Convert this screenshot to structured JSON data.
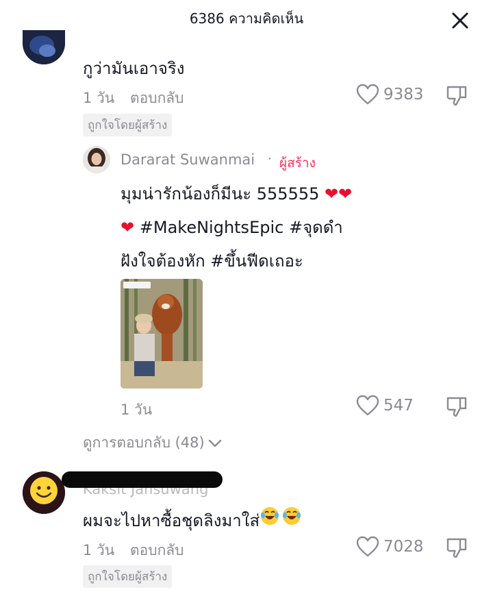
{
  "header": {
    "title": "6386 ความคิดเห็น"
  },
  "comment1": {
    "text": "กูว่ามันเอาจริง",
    "time": "1 วัน",
    "reply_label": "ตอบกลับ",
    "likes": "9383",
    "liked_by_creator": "ถูกใจโดยผู้สร้าง"
  },
  "reply1": {
    "author": "Dararat Suwanmai",
    "separator": "·",
    "creator_label": "ผู้สร้าง",
    "line1_text": "มุมน่ารักน้องก็มีนะ 555555",
    "line2_text": "#MakeNightsEpic  #จุดดำ",
    "line3_text": "ฝังใจต้องหัก #ขึ้นฟีดเถอะ",
    "time": "1 วัน",
    "likes": "547"
  },
  "view_replies": {
    "label": "ดูการตอบกลับ (48)"
  },
  "comment2": {
    "author_partial": "Kaksit Jansuwang",
    "text": "ผมจะไปหาซื้อชุดลิงมาใส่",
    "time": "1 วัน",
    "reply_label": "ตอบกลับ",
    "likes": "7028",
    "liked_by_creator": "ถูกใจโดยผู้สร้าง"
  },
  "colors": {
    "creator_red": "#fe2c55",
    "meta_gray": "#8a8b91",
    "text": "#161823"
  },
  "icons": [
    "close-icon",
    "heart-outline-icon",
    "dislike-icon",
    "chevron-down-icon",
    "smiley-icon",
    "laughing-emoji-icon",
    "red-heart-emoji"
  ]
}
